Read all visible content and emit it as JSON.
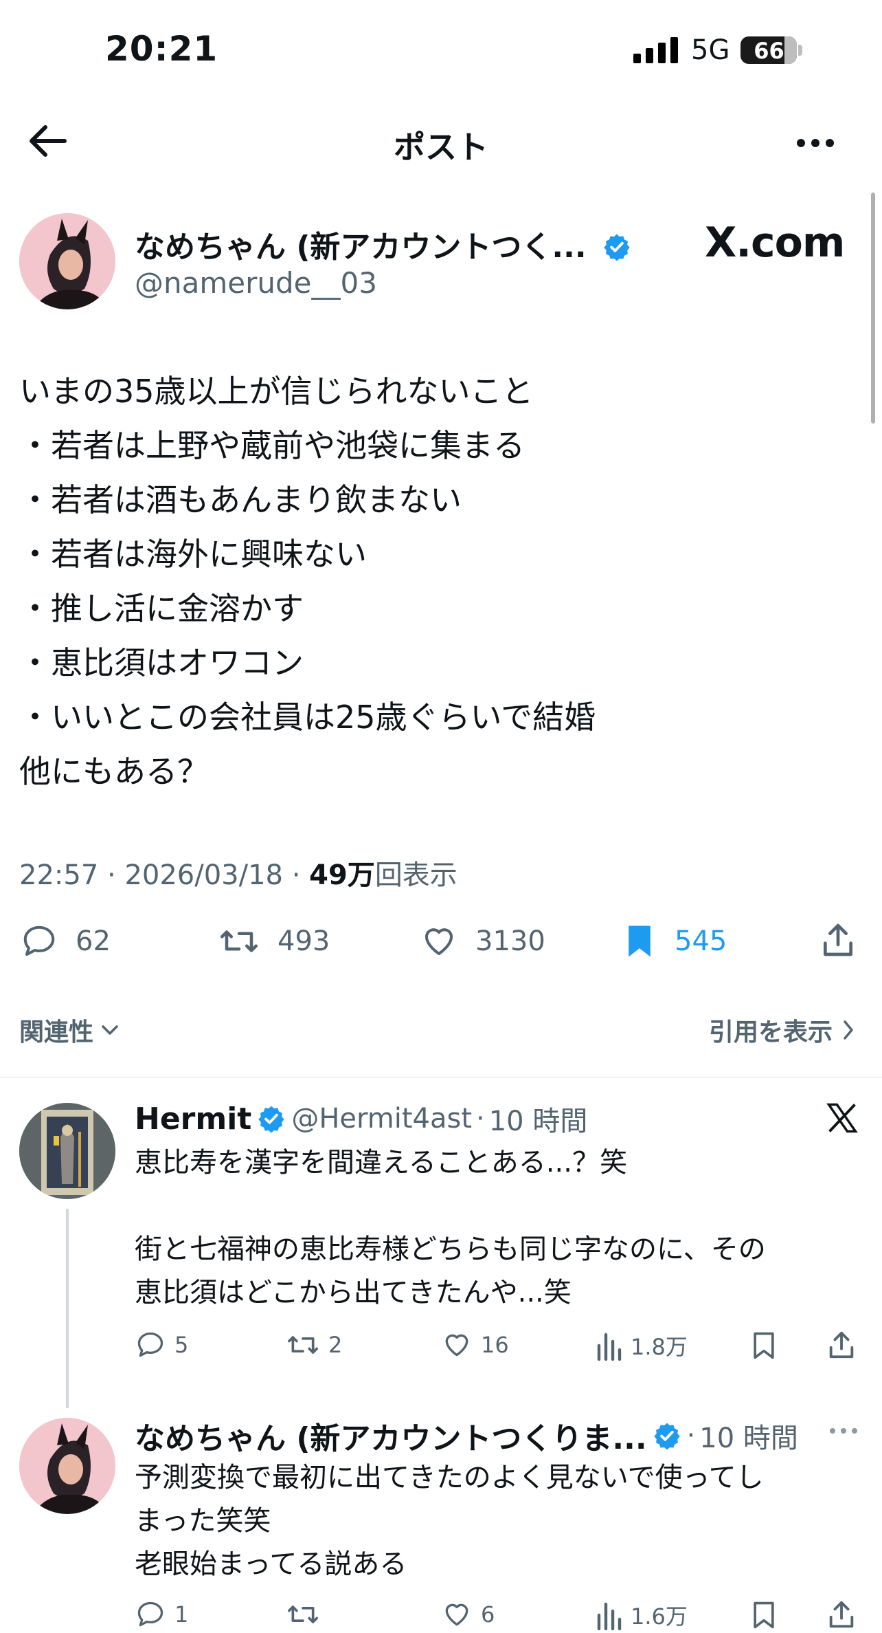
{
  "status_bar": {
    "time": "20:21",
    "network": "5G",
    "battery": "66"
  },
  "header": {
    "title": "ポスト"
  },
  "post": {
    "author_name": "なめちゃん (新アカウントつく...",
    "author_handle": "@namerude__03",
    "watermark": "X.com",
    "body_lines": [
      "いまの35歳以上が信じられないこと",
      "・若者は上野や蔵前や池袋に集まる",
      "・若者は酒もあんまり飲まない",
      "・若者は海外に興味ない",
      "・推し活に金溶かす",
      "・恵比須はオワコン",
      "・いいとこの会社員は25歳ぐらいで結婚",
      "他にもある？"
    ],
    "time": "22:57",
    "date": "2026/03/18",
    "views_count": "49万",
    "views_label": "回表示",
    "stats": {
      "replies": "62",
      "reposts": "493",
      "likes": "3130",
      "bookmarks": "545"
    }
  },
  "filters": {
    "sort_label": "関連性",
    "quotes_label": "引用を表示"
  },
  "replies": [
    {
      "name": "Hermit",
      "handle": "@Hermit4ast",
      "time": "10 時間",
      "text_lines": [
        "恵比寿を漢字を間違えることある...？笑",
        "",
        "街と七福神の恵比寿様どちらも同じ字なのに、その",
        "恵比須はどこから出てきたんや...笑"
      ],
      "stats": {
        "replies": "5",
        "reposts": "2",
        "likes": "16",
        "views": "1.8万"
      }
    },
    {
      "name": "なめちゃん (新アカウントつくりま...",
      "handle": "",
      "time": "10 時間",
      "text_lines": [
        "予測変換で最初に出てきたのよく見ないで使ってし",
        "まった笑笑",
        "老眼始まってる説ある"
      ],
      "stats": {
        "replies": "1",
        "reposts": "",
        "likes": "6",
        "views": "1.6万"
      }
    }
  ],
  "colors": {
    "accent": "#1d9bf0",
    "text": "#0f1419",
    "secondary": "#536471"
  }
}
